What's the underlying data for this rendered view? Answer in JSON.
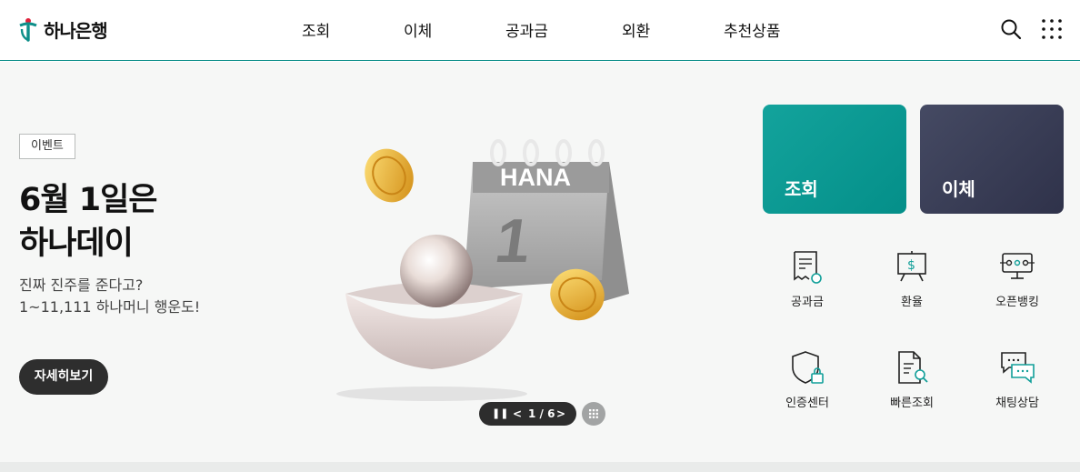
{
  "header": {
    "logo_text": "하나은행",
    "nav": [
      "조회",
      "이체",
      "공과금",
      "외환",
      "추천상품"
    ]
  },
  "banner": {
    "tag": "이벤트",
    "headline_line1": "6월 1일은",
    "headline_line2": "하나데이",
    "desc_line1": "진짜 진주를 준다고?",
    "desc_line2": "1~11,111 하나머니 행운도!",
    "button": "자세히보기",
    "calendar_brand": "HANA",
    "calendar_day": "1",
    "pager": "1 / 6"
  },
  "cards": {
    "primary": "조회",
    "secondary": "이체"
  },
  "quick_menu": [
    "공과금",
    "환율",
    "오픈뱅킹",
    "인증센터",
    "빠른조회",
    "채팅상담"
  ],
  "colors": {
    "brand": "#0e8f8a",
    "card_primary": "#0a9a93",
    "card_secondary": "#3a3d55",
    "dark_button": "#2e2e2e",
    "background": "#f6f7f6"
  }
}
